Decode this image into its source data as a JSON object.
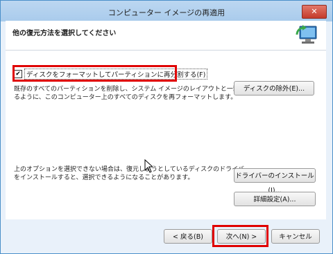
{
  "window": {
    "title": "コンピューター イメージの再適用"
  },
  "titlebar": {
    "close_label": "✕"
  },
  "header": {
    "heading": "他の復元方法を選択してください",
    "icon": "computer-restore-icon"
  },
  "format_option": {
    "checked": true,
    "check_glyph": "✔",
    "label": "ディスクをフォーマットしてパーティションに再分割する(F)",
    "description_line1": "既存のすべてのパーティションを削除し、システム イメージのレイアウトと一致す",
    "description_line2": "るように、このコンピューター上のすべてのディスクを再フォーマットします。",
    "exclude_button": "ディスクの除外(E)..."
  },
  "driver_option": {
    "description_line1": "上のオプションを選択できない場合は、復元しようとしているディスクのドライバー",
    "description_line2": "をインストールすると、選択できるようになることがあります。",
    "install_button": "ドライバーのインストール(I)...",
    "advanced_button": "詳細設定(A)..."
  },
  "footer": {
    "back_button": "< 戻る(B)",
    "next_button": "次へ(N) >",
    "cancel_button": "キャンセル"
  },
  "colors": {
    "highlight": "#e00000",
    "titlebar": "#a9cbec",
    "close": "#c43b2b"
  }
}
